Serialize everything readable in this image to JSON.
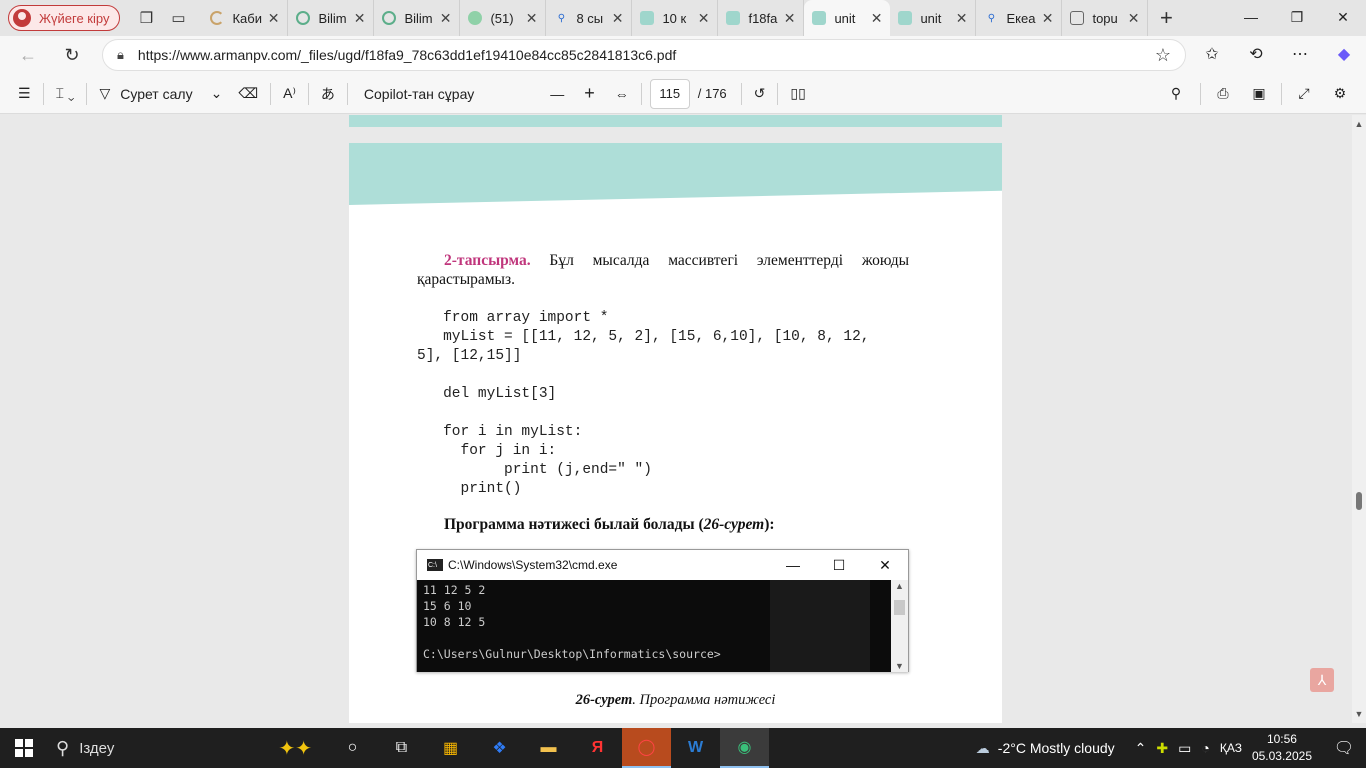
{
  "browser": {
    "profile_label": "Жүйеге кіру",
    "tabs": [
      {
        "title": "Каби",
        "icon": "loading-icon"
      },
      {
        "title": "Bilim",
        "icon": "site-icon"
      },
      {
        "title": "Bilim",
        "icon": "site-icon"
      },
      {
        "title": "(51)",
        "icon": "site-icon"
      },
      {
        "title": "8 сы",
        "icon": "search-icon"
      },
      {
        "title": "10 к",
        "icon": "pdf-icon"
      },
      {
        "title": "f18fa",
        "icon": "pdf-icon"
      },
      {
        "title": "unit",
        "icon": "pdf-icon"
      },
      {
        "title": "unit",
        "icon": "pdf-icon"
      },
      {
        "title": "Екеа",
        "icon": "search-icon"
      },
      {
        "title": "topu",
        "icon": "document-icon"
      }
    ],
    "url": "https://www.armanpv.com/_files/ugd/f18fa9_78c63dd1ef19410e84cc85c2841813c6.pdf"
  },
  "pdf_toolbar": {
    "draw_label": "Сурет салу",
    "copilot_label": "Copilot-тан сұрау",
    "page_current": "115",
    "page_total": "/ 176"
  },
  "document": {
    "task_label": "2-тапсырма.",
    "task_text": " Бұл мысалда массивтегі элементтерді жоюды қарастырамыз.",
    "code_block1": "   from array import *\n   myList = [[11, 12, 5, 2], [15, 6,10], [10, 8, 12,\n5], [12,15]]",
    "code_block2": "   del myList[3]",
    "code_block3": "   for i in myList:\n     for j in i:\n          print (j,end=\" \")\n     print()",
    "result_prefix": "Программа нәтижесі былай болады (",
    "result_ref": "26-сурет",
    "result_suffix": "):",
    "caption_num": "26-сурет",
    "caption_text": ". Программа нәтижесі",
    "cmd_title": "C:\\Windows\\System32\\cmd.exe",
    "cmd_output": "11 12 5 2\n15 6 10\n10 8 12 5\n\nC:\\Users\\Gulnur\\Desktop\\Informatics\\source>"
  },
  "taskbar": {
    "search_placeholder": "Іздеу",
    "weather": "-2°C  Mostly cloudy",
    "lang": "ҚАЗ",
    "time": "10:56",
    "date": "05.03.2025"
  }
}
